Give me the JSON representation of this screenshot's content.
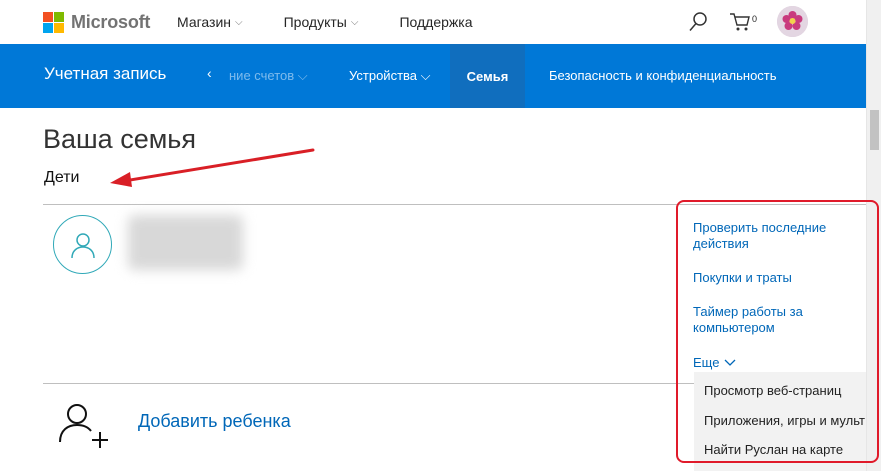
{
  "header": {
    "brand": "Microsoft",
    "nav": [
      {
        "label": "Магазин"
      },
      {
        "label": "Продукты"
      },
      {
        "label": "Поддержка"
      }
    ],
    "cart_count": "0"
  },
  "subnav": {
    "title": "Учетная запись",
    "left_arrow": "‹",
    "faded_item": "ние счетов",
    "devices": "Устройства",
    "family": "Семья",
    "security": "Безопасность и конфиденциальность"
  },
  "main": {
    "page_title": "Ваша семья",
    "section_label": "Дети",
    "add_child": "Добавить ребенка"
  },
  "actions": {
    "recent_activity": "Проверить последние действия",
    "purchases": "Покупки и траты",
    "screen_time": "Таймер работы за компьютером",
    "more": "Еще",
    "dropdown": [
      "Просмотр веб-страниц",
      "Приложения, игры и мульт",
      "Найти Руслан на карте"
    ]
  },
  "colors": {
    "accent": "#0078d7",
    "selected_tab": "#106ebe",
    "link": "#0067b8",
    "annotation": "#e01a2a"
  }
}
